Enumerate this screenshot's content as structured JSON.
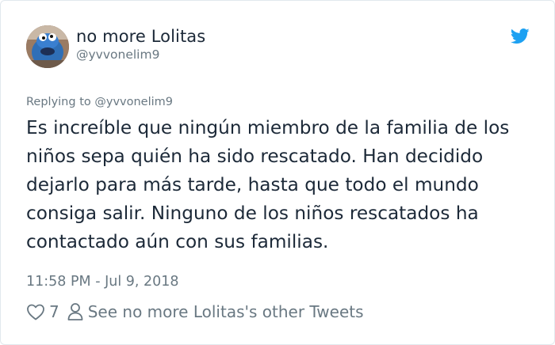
{
  "tweet": {
    "author_name": "no more Lolitas",
    "author_handle": "@yvvonelim9",
    "replying_prefix": "Replying to",
    "replying_handle": "@yvvonelim9",
    "text": "Es increíble que ningún miembro de la familia de los niños sepa quién ha sido rescatado. Han decidido dejarlo para más tarde, hasta que todo el mundo consiga salir. Ninguno de los niños rescatados ha contactado aún con sus familias.",
    "timestamp": "11:58 PM - Jul 9, 2018",
    "like_count": "7",
    "other_tweets_label": "See no more Lolitas's other Tweets"
  },
  "colors": {
    "twitter_blue": "#1da1f2",
    "text_primary": "#1c2938",
    "text_secondary": "#697882",
    "border": "#e1e8ed"
  },
  "icons": {
    "logo": "twitter-bird-icon",
    "like": "heart-outline-icon",
    "profile": "person-outline-icon"
  }
}
